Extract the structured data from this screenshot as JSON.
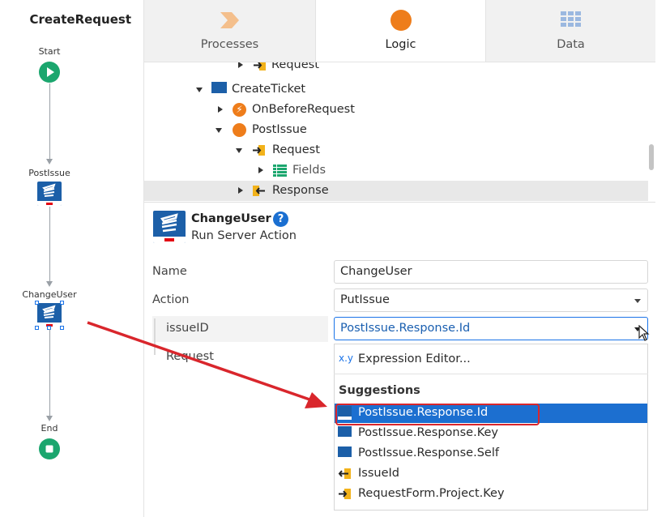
{
  "flow": {
    "title": "CreateRequest",
    "nodes": {
      "start": "Start",
      "post_issue": "PostIssue",
      "change_user": "ChangeUser",
      "end": "End"
    }
  },
  "tabs": [
    {
      "label": "Processes",
      "icon": "chevron-process-icon",
      "active": false
    },
    {
      "label": "Logic",
      "icon": "orange-circle-icon",
      "active": true
    },
    {
      "label": "Data",
      "icon": "table-grid-icon",
      "active": false
    }
  ],
  "tree": {
    "items": [
      {
        "label": "Request"
      },
      {
        "label": "CreateTicket"
      },
      {
        "label": "OnBeforeRequest"
      },
      {
        "label": "PostIssue"
      },
      {
        "label": "Request"
      },
      {
        "label": "Fields"
      },
      {
        "label": "Response"
      }
    ]
  },
  "properties": {
    "title": "ChangeUser",
    "help": "?",
    "subtitle": "Run Server Action",
    "rows": {
      "name_label": "Name",
      "name_value": "ChangeUser",
      "action_label": "Action",
      "action_value": "PutIssue",
      "param_label": "issueID",
      "param_value": "PostIssue.Response.Id",
      "request_label": "Request"
    }
  },
  "dropdown": {
    "expr_icon": "x.y",
    "expr_label": "Expression Editor...",
    "suggestions_header": "Suggestions",
    "items": [
      {
        "label": "PostIssue.Response.Id",
        "highlighted": true
      },
      {
        "label": "PostIssue.Response.Key"
      },
      {
        "label": "PostIssue.Response.Self"
      },
      {
        "label": "IssueId"
      },
      {
        "label": "RequestForm.Project.Key"
      }
    ]
  },
  "colors": {
    "flow_green": "#1ba66e",
    "action_blue": "#1c5fa8",
    "logic_orange": "#ee7d1b",
    "selection_blue": "#1c6fd0",
    "annotation_red": "#d9262c"
  }
}
